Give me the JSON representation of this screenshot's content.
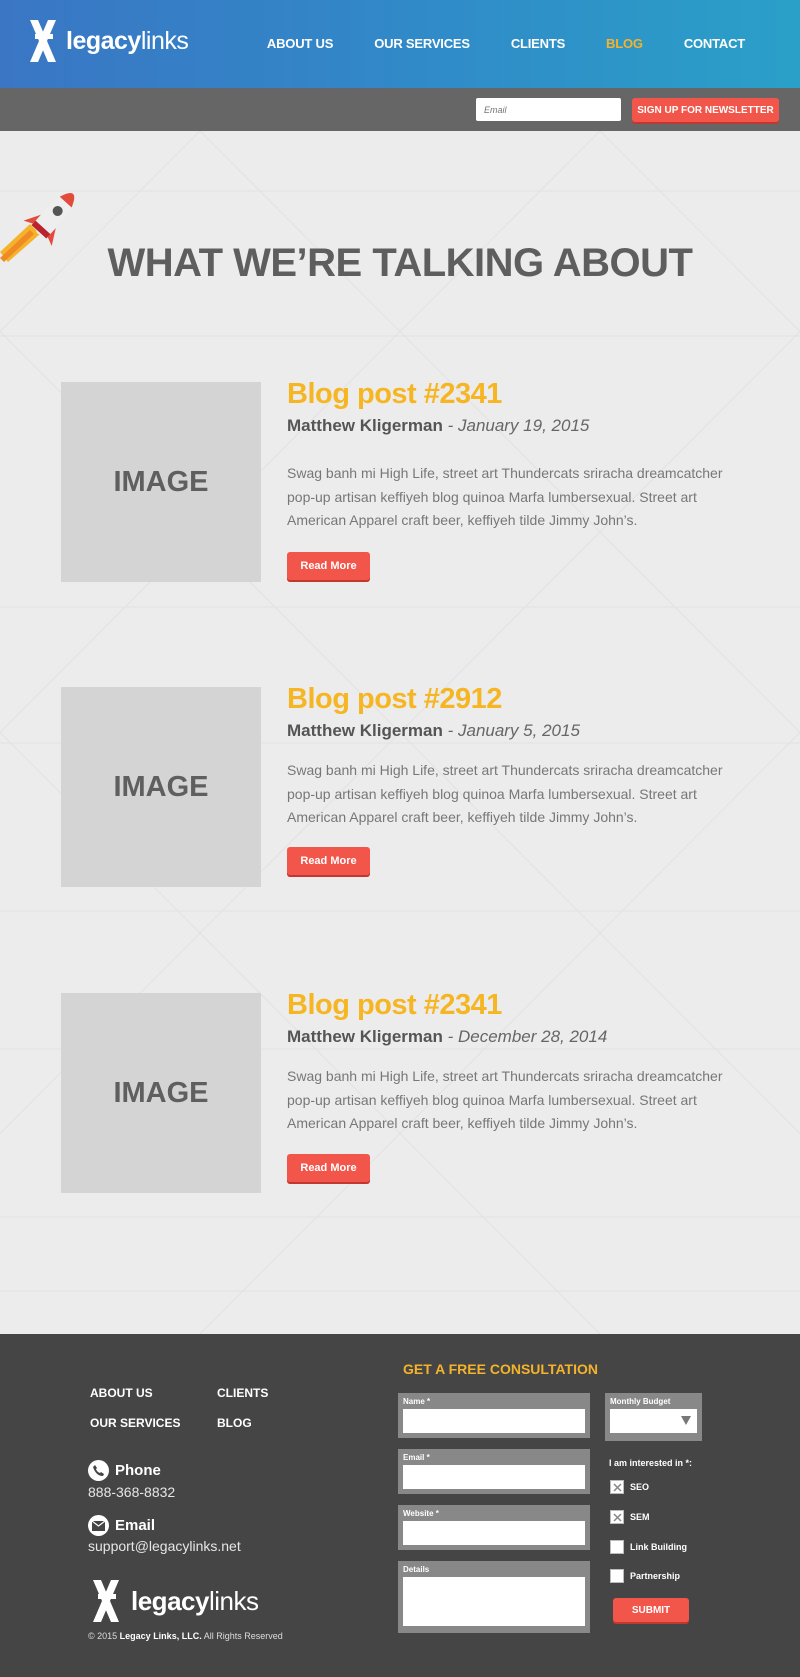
{
  "header": {
    "logo": {
      "bold": "legacy",
      "rest": "links"
    },
    "nav": [
      {
        "label": "ABOUT US",
        "active": false
      },
      {
        "label": "OUR SERVICES",
        "active": false
      },
      {
        "label": "CLIENTS",
        "active": false
      },
      {
        "label": "BLOG",
        "active": true
      },
      {
        "label": "CONTACT",
        "active": false
      }
    ]
  },
  "newsletter": {
    "email_placeholder": "Email",
    "button_label": "SIGN UP FOR NEWSLETTER"
  },
  "main": {
    "title": "WHAT WE’RE TALKING ABOUT",
    "posts": [
      {
        "image_label": "IMAGE",
        "title": "Blog post #2341",
        "author": "Matthew Kligerman",
        "date": "January 19, 2015",
        "excerpt": "Swag banh mi High Life, street art Thundercats sriracha dreamcatcher pop-up artisan keffiyeh blog quinoa Marfa lumbersexual. Street art American Apparel craft beer, keffiyeh tilde Jimmy John’s.",
        "button": "Read More"
      },
      {
        "image_label": "IMAGE",
        "title": "Blog post #2912",
        "author": "Matthew Kligerman",
        "date": "January 5, 2015",
        "excerpt": "Swag banh mi High Life, street art Thundercats sriracha dreamcatcher pop-up artisan keffiyeh blog quinoa Marfa lumbersexual. Street art American Apparel craft beer, keffiyeh tilde Jimmy John’s.",
        "button": "Read More"
      },
      {
        "image_label": "IMAGE",
        "title": "Blog post #2341",
        "author": "Matthew Kligerman",
        "date": "December 28, 2014",
        "excerpt": "Swag banh mi High Life, street art Thundercats sriracha dreamcatcher pop-up artisan keffiyeh blog quinoa Marfa lumbersexual. Street art American Apparel craft beer, keffiyeh tilde Jimmy John’s.",
        "button": "Read More"
      }
    ]
  },
  "footer": {
    "links": [
      "ABOUT US",
      "CLIENTS",
      "OUR SERVICES",
      "BLOG"
    ],
    "phone_label": "Phone",
    "phone": "888-368-8832",
    "email_label": "Email",
    "email": "support@legacylinks.net",
    "logo": {
      "bold": "legacy",
      "rest": "links"
    },
    "copyright_prefix": "© 2015",
    "copyright_company": "Legacy Links, LLC.",
    "copyright_suffix": "All Rights Reserved",
    "consult_title": "GET A FREE CONSULTATION",
    "form": {
      "name_label": "Name *",
      "email_label": "Email *",
      "website_label": "Website *",
      "details_label": "Details",
      "budget_label": "Monthly Budget",
      "interest_label": "I am interested in *:",
      "options": [
        {
          "label": "SEO",
          "checked": true
        },
        {
          "label": "SEM",
          "checked": true
        },
        {
          "label": "Link Building",
          "checked": false
        },
        {
          "label": "Partnership",
          "checked": false
        }
      ],
      "submit": "SUBMIT"
    }
  },
  "colors": {
    "accent": "#f2564b",
    "highlight": "#f5b32b",
    "header_start": "#3a76c4",
    "header_end": "#2aa0c8",
    "footer_bg": "#454545"
  }
}
